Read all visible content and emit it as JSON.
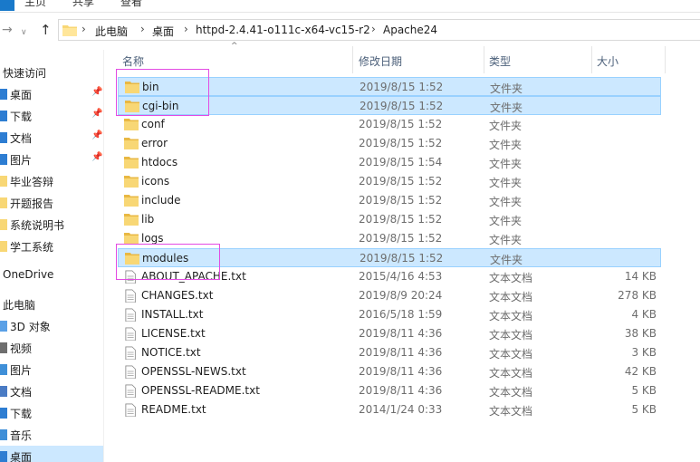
{
  "ribbon": {
    "tabs": [
      "主页",
      "共享",
      "查看"
    ]
  },
  "address": {
    "crumbs": [
      "此电脑",
      "桌面",
      "httpd-2.4.41-o111c-x64-vc15-r2",
      "Apache24"
    ],
    "back_icon": "back-arrow-icon",
    "forward_icon": "forward-arrow-icon",
    "up_icon": "up-arrow-icon"
  },
  "sidebar": {
    "quick_access": "快速访问",
    "items": [
      {
        "label": "桌面",
        "pinned": true,
        "icon": "desktop-icon"
      },
      {
        "label": "下载",
        "pinned": true,
        "icon": "download-icon"
      },
      {
        "label": "文档",
        "pinned": true,
        "icon": "documents-icon"
      },
      {
        "label": "图片",
        "pinned": true,
        "icon": "pictures-icon"
      },
      {
        "label": "毕业答辩",
        "pinned": false,
        "icon": "folder-icon"
      },
      {
        "label": "开题报告",
        "pinned": false,
        "icon": "folder-icon"
      },
      {
        "label": "系统说明书",
        "pinned": false,
        "icon": "folder-icon"
      },
      {
        "label": "学工系统",
        "pinned": false,
        "icon": "folder-icon"
      }
    ],
    "onedrive": "OneDrive",
    "this_pc": "此电脑",
    "pc_items": [
      {
        "label": "3D 对象",
        "icon": "3d-objects-icon"
      },
      {
        "label": "视频",
        "icon": "videos-icon"
      },
      {
        "label": "图片",
        "icon": "pictures-icon"
      },
      {
        "label": "文档",
        "icon": "documents-icon"
      },
      {
        "label": "下载",
        "icon": "download-icon"
      },
      {
        "label": "音乐",
        "icon": "music-icon"
      },
      {
        "label": "桌面",
        "icon": "desktop-icon"
      }
    ]
  },
  "columns": {
    "name": "名称",
    "date": "修改日期",
    "type": "类型",
    "size": "大小"
  },
  "files": [
    {
      "name": "bin",
      "date": "2019/8/15 1:52",
      "type": "文件夹",
      "size": "",
      "kind": "folder",
      "selected": true
    },
    {
      "name": "cgi-bin",
      "date": "2019/8/15 1:52",
      "type": "文件夹",
      "size": "",
      "kind": "folder",
      "selected": true
    },
    {
      "name": "conf",
      "date": "2019/8/15 1:52",
      "type": "文件夹",
      "size": "",
      "kind": "folder",
      "selected": false
    },
    {
      "name": "error",
      "date": "2019/8/15 1:52",
      "type": "文件夹",
      "size": "",
      "kind": "folder",
      "selected": false
    },
    {
      "name": "htdocs",
      "date": "2019/8/15 1:54",
      "type": "文件夹",
      "size": "",
      "kind": "folder",
      "selected": false
    },
    {
      "name": "icons",
      "date": "2019/8/15 1:52",
      "type": "文件夹",
      "size": "",
      "kind": "folder",
      "selected": false
    },
    {
      "name": "include",
      "date": "2019/8/15 1:52",
      "type": "文件夹",
      "size": "",
      "kind": "folder",
      "selected": false
    },
    {
      "name": "lib",
      "date": "2019/8/15 1:52",
      "type": "文件夹",
      "size": "",
      "kind": "folder",
      "selected": false
    },
    {
      "name": "logs",
      "date": "2019/8/15 1:52",
      "type": "文件夹",
      "size": "",
      "kind": "folder",
      "selected": false
    },
    {
      "name": "modules",
      "date": "2019/8/15 1:52",
      "type": "文件夹",
      "size": "",
      "kind": "folder",
      "selected": true
    },
    {
      "name": "ABOUT_APACHE.txt",
      "date": "2015/4/16 4:53",
      "type": "文本文档",
      "size": "14 KB",
      "kind": "file",
      "selected": false
    },
    {
      "name": "CHANGES.txt",
      "date": "2019/8/9 20:24",
      "type": "文本文档",
      "size": "278 KB",
      "kind": "file",
      "selected": false
    },
    {
      "name": "INSTALL.txt",
      "date": "2016/5/18 1:59",
      "type": "文本文档",
      "size": "4 KB",
      "kind": "file",
      "selected": false
    },
    {
      "name": "LICENSE.txt",
      "date": "2019/8/11 4:36",
      "type": "文本文档",
      "size": "38 KB",
      "kind": "file",
      "selected": false
    },
    {
      "name": "NOTICE.txt",
      "date": "2019/8/11 4:36",
      "type": "文本文档",
      "size": "3 KB",
      "kind": "file",
      "selected": false
    },
    {
      "name": "OPENSSL-NEWS.txt",
      "date": "2019/8/11 4:36",
      "type": "文本文档",
      "size": "42 KB",
      "kind": "file",
      "selected": false
    },
    {
      "name": "OPENSSL-README.txt",
      "date": "2019/8/11 4:36",
      "type": "文本文档",
      "size": "5 KB",
      "kind": "file",
      "selected": false
    },
    {
      "name": "README.txt",
      "date": "2014/1/24 0:33",
      "type": "文本文档",
      "size": "5 KB",
      "kind": "file",
      "selected": false
    }
  ],
  "colors": {
    "selection": "#cce8ff",
    "selection_border": "#99d1ff",
    "annotation": "#e34be3",
    "folder": "#f8d775",
    "header_text": "#4c607a"
  }
}
